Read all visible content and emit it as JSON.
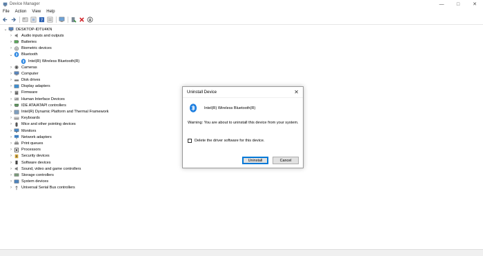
{
  "window": {
    "title": "Device Manager"
  },
  "menu": [
    "File",
    "Action",
    "View",
    "Help"
  ],
  "toolbar": [
    "back-arrow-icon",
    "forward-arrow-icon",
    "properties-icon",
    "update-icon",
    "help-icon",
    "resources-icon",
    "monitor-icon",
    "enable-device-icon",
    "uninstall-icon",
    "download-icon"
  ],
  "tree": {
    "root": "DESKTOP-IDTU4KN",
    "items": [
      {
        "label": "Audio inputs and outputs",
        "icon": "speaker-icon"
      },
      {
        "label": "Batteries",
        "icon": "battery-icon"
      },
      {
        "label": "Biometric devices",
        "icon": "biometric-icon"
      },
      {
        "label": "Bluetooth",
        "icon": "bluetooth-icon",
        "expanded": true
      },
      {
        "label": "Intel(R) Wireless Bluetooth(R)",
        "icon": "bluetooth-icon",
        "child": true
      },
      {
        "label": "Cameras",
        "icon": "camera-icon"
      },
      {
        "label": "Computer",
        "icon": "computer-icon"
      },
      {
        "label": "Disk drives",
        "icon": "disk-icon"
      },
      {
        "label": "Display adapters",
        "icon": "display-icon"
      },
      {
        "label": "Firmware",
        "icon": "firmware-icon"
      },
      {
        "label": "Human Interface Devices",
        "icon": "hid-icon"
      },
      {
        "label": "IDE ATA/ATAPI controllers",
        "icon": "ide-icon"
      },
      {
        "label": "Intel(R) Dynamic Platform and Thermal Framework",
        "icon": "chip-icon"
      },
      {
        "label": "Keyboards",
        "icon": "keyboard-icon"
      },
      {
        "label": "Mice and other pointing devices",
        "icon": "mouse-icon"
      },
      {
        "label": "Monitors",
        "icon": "monitor-icon"
      },
      {
        "label": "Network adapters",
        "icon": "network-icon"
      },
      {
        "label": "Print queues",
        "icon": "printer-icon"
      },
      {
        "label": "Processors",
        "icon": "processor-icon"
      },
      {
        "label": "Security devices",
        "icon": "security-icon"
      },
      {
        "label": "Software devices",
        "icon": "software-icon"
      },
      {
        "label": "Sound, video and game controllers",
        "icon": "sound-icon"
      },
      {
        "label": "Storage controllers",
        "icon": "storage-icon"
      },
      {
        "label": "System devices",
        "icon": "system-icon"
      },
      {
        "label": "Universal Serial Bus controllers",
        "icon": "usb-icon"
      }
    ]
  },
  "dialog": {
    "title": "Uninstall Device",
    "device_name": "Intel(R) Wireless Bluetooth(R)",
    "warning": "Warning: You are about to uninstall this device from your system.",
    "checkbox_label": "Delete the driver software for this device.",
    "checkbox_checked": false,
    "uninstall_label": "Uninstall",
    "cancel_label": "Cancel"
  },
  "colors": {
    "accent": "#0078d7",
    "bluetooth": "#1e7fe0"
  }
}
